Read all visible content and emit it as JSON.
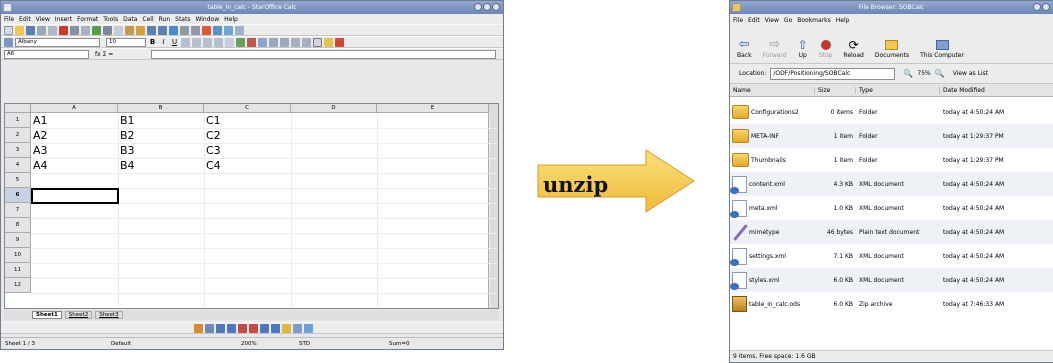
{
  "calc": {
    "title": "table_in_calc - StarOffice Calc",
    "menu": [
      "File",
      "Edit",
      "View",
      "Insert",
      "Format",
      "Tools",
      "Data",
      "Cell",
      "Run",
      "Stats",
      "Window",
      "Help"
    ],
    "font_name": "Albany",
    "font_size": "10",
    "cell_ref": "A6",
    "formula_symbols": "fx Σ =",
    "columns": [
      "A",
      "B",
      "C",
      "D",
      "E"
    ],
    "rows": [
      "1",
      "2",
      "3",
      "4",
      "5",
      "6",
      "7",
      "8",
      "9",
      "10",
      "11",
      "12"
    ],
    "cells": [
      [
        "A1",
        "B1",
        "C1"
      ],
      [
        "A2",
        "B2",
        "C2"
      ],
      [
        "A3",
        "B3",
        "C3"
      ],
      [
        "A4",
        "B4",
        "C4"
      ]
    ],
    "sheet_tabs": [
      "Sheet1",
      "Sheet2",
      "Sheet3"
    ],
    "status": {
      "sheet": "Sheet 1 / 3",
      "style": "Default",
      "zoom": "200%",
      "mode": "STD",
      "sum": "Sum=0"
    }
  },
  "arrow_label": "unzip",
  "browser": {
    "title": "File Browser: SOBCalc",
    "menu": [
      "File",
      "Edit",
      "View",
      "Go",
      "Bookmarks",
      "Help"
    ],
    "toolbar": [
      "Back",
      "Forward",
      "Up",
      "Stop",
      "Reload",
      "Documents",
      "This Computer"
    ],
    "location_label": "Location:",
    "location_value": "/ODF/Positioning/SOBCalc",
    "zoom": "75%",
    "view_as": "View as List",
    "columns": {
      "name": "Name",
      "size": "Size",
      "type": "Type",
      "date": "Date Modified"
    },
    "files": [
      {
        "name": "Configurations2",
        "size": "0 items",
        "type": "Folder",
        "date": "today at 4:50:24 AM",
        "icon": "folder-icon"
      },
      {
        "name": "META-INF",
        "size": "1 item",
        "type": "Folder",
        "date": "today at 1:29:37 PM",
        "icon": "folder-icon"
      },
      {
        "name": "Thumbnails",
        "size": "1 item",
        "type": "Folder",
        "date": "today at 1:29:37 PM",
        "icon": "folder-icon"
      },
      {
        "name": "content.xml",
        "size": "4.3 KB",
        "type": "XML document",
        "date": "today at 4:50:24 AM",
        "icon": "xml-file-icon"
      },
      {
        "name": "meta.xml",
        "size": "1.0 KB",
        "type": "XML document",
        "date": "today at 4:50:24 AM",
        "icon": "xml-file-icon"
      },
      {
        "name": "mimetype",
        "size": "46 bytes",
        "type": "Plain text document",
        "date": "today at 4:50:24 AM",
        "icon": "text-file-icon"
      },
      {
        "name": "settings.xml",
        "size": "7.1 KB",
        "type": "XML document",
        "date": "today at 4:50:24 AM",
        "icon": "xml-file-icon"
      },
      {
        "name": "styles.xml",
        "size": "6.0 KB",
        "type": "XML document",
        "date": "today at 4:50:24 AM",
        "icon": "xml-file-icon"
      },
      {
        "name": "table_in_calc.ods",
        "size": "6.0 KB",
        "type": "Zip archive",
        "date": "today at 7:46:33 AM",
        "icon": "zip-file-icon"
      }
    ],
    "status": "9 items, Free space: 1.6 GB"
  }
}
